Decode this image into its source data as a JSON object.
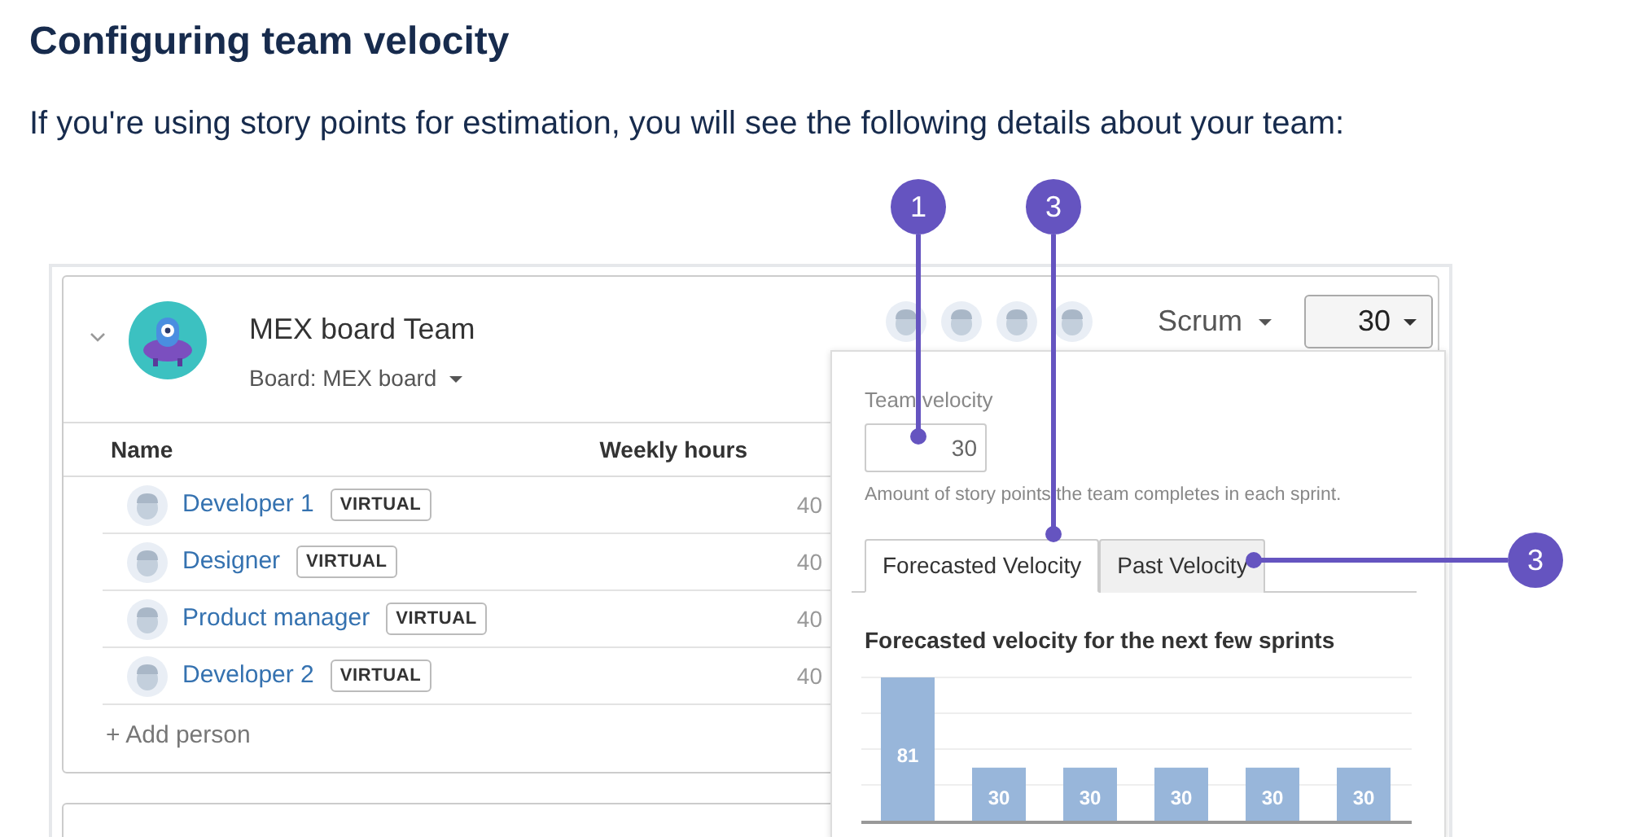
{
  "heading": "Configuring team velocity",
  "intro": "If you're using story points for estimation, you will see the following details about your team:",
  "team": {
    "name": "MEX board Team",
    "board": "Board: MEX board",
    "method": "Scrum",
    "velocity_select": "30"
  },
  "table": {
    "columns": [
      "Name",
      "Weekly hours"
    ],
    "rows": [
      {
        "name": "Developer 1",
        "tag": "VIRTUAL",
        "hours": "40"
      },
      {
        "name": "Designer",
        "tag": "VIRTUAL",
        "hours": "40"
      },
      {
        "name": "Product manager",
        "tag": "VIRTUAL",
        "hours": "40"
      },
      {
        "name": "Developer 2",
        "tag": "VIRTUAL",
        "hours": "40"
      }
    ],
    "add_link": "+ Add person"
  },
  "popup": {
    "label": "Team velocity",
    "value": "30",
    "help": "Amount of story points the team completes in each sprint.",
    "tabs": [
      {
        "label": "Forecasted Velocity",
        "selected": true
      },
      {
        "label": "Past Velocity",
        "selected": false
      }
    ],
    "chart_title": "Forecasted velocity for the next few sprints",
    "bar_labels": [
      "81",
      "30",
      "30",
      "30",
      "30",
      "30"
    ]
  },
  "callouts": [
    {
      "label": "1"
    },
    {
      "label": "3"
    },
    {
      "label": "3"
    }
  ]
}
